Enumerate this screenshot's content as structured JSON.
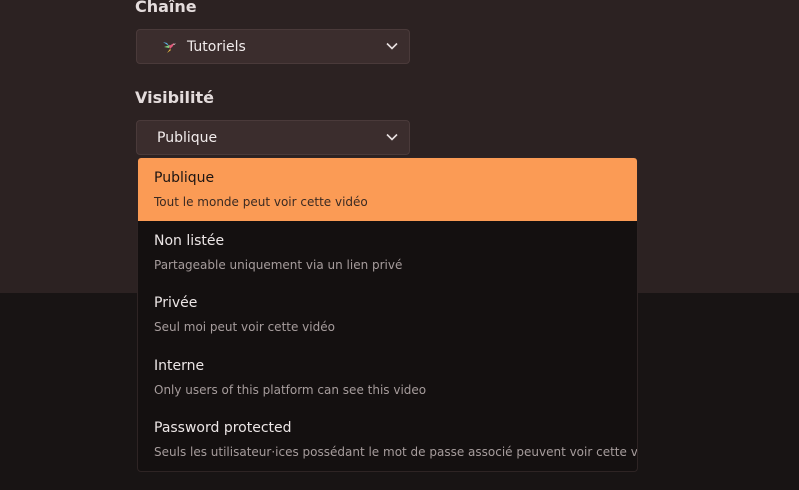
{
  "channel": {
    "label": "Chaîne",
    "value": "Tutoriels",
    "icon": "hummingbird-icon"
  },
  "visibility": {
    "label": "Visibilité",
    "value": "Publique",
    "options": [
      {
        "title": "Publique",
        "description": "Tout le monde peut voir cette vidéo",
        "selected": true
      },
      {
        "title": "Non listée",
        "description": "Partageable uniquement via un lien privé",
        "selected": false
      },
      {
        "title": "Privée",
        "description": "Seul moi peut voir cette vidéo",
        "selected": false
      },
      {
        "title": "Interne",
        "description": "Only users of this platform can see this video",
        "selected": false
      },
      {
        "title": "Password protected",
        "description": "Seuls les utilisateur·ices possédant le mot de passe associé peuvent voir cette vidéo",
        "selected": false
      }
    ]
  },
  "colors": {
    "accent": "#fb9b55",
    "panel": "#2c2222",
    "background": "#181414"
  }
}
